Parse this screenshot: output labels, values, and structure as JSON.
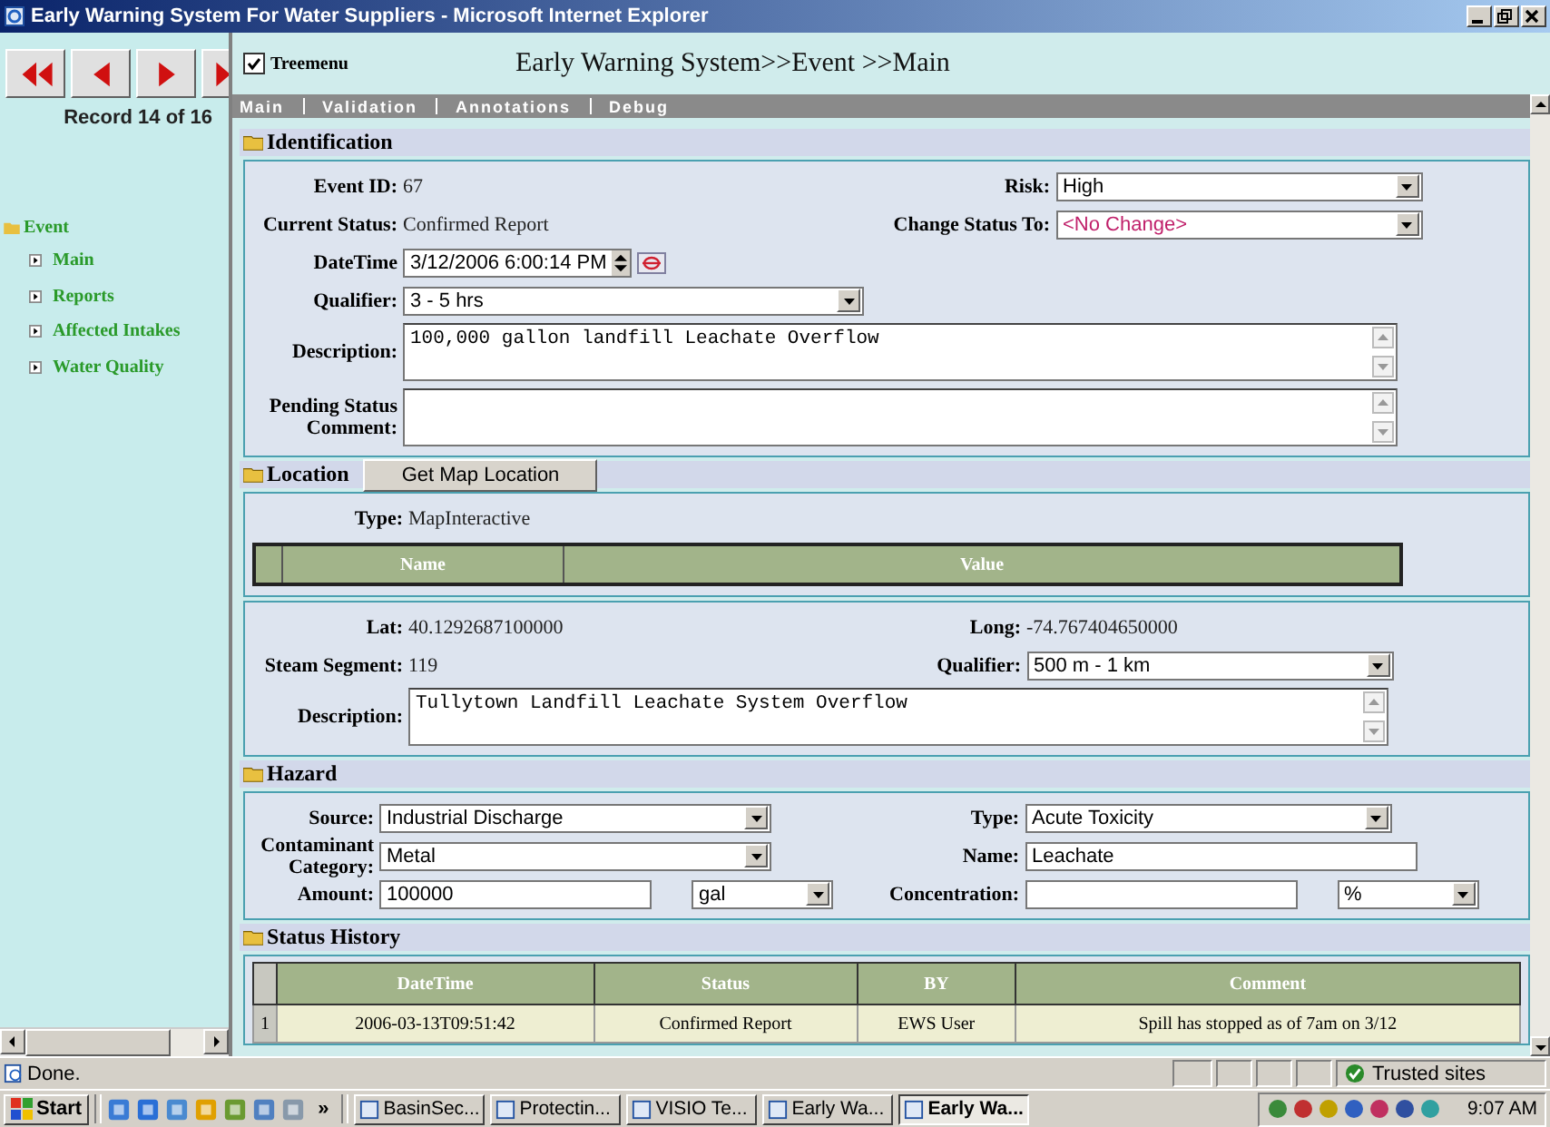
{
  "window": {
    "title": "Early Warning System For Water Suppliers - Microsoft Internet Explorer"
  },
  "nav": {
    "buttons": [
      {
        "kind": "first"
      },
      {
        "kind": "prev"
      },
      {
        "kind": "next"
      },
      {
        "kind": "last"
      }
    ],
    "record": "Record 14 of 16"
  },
  "tree": {
    "label": "Event",
    "children": [
      {
        "label": "Main"
      },
      {
        "label": "Reports"
      },
      {
        "label": "Affected Intakes"
      },
      {
        "label": "Water Quality"
      }
    ]
  },
  "header": {
    "treemenu": {
      "label": "Treemenu",
      "checked": true
    },
    "title": "Early Warning System>>Event >>Main"
  },
  "menu": [
    "Main",
    "Validation",
    "Annotations",
    "Debug"
  ],
  "identification": {
    "title": "Identification",
    "rows": [
      {
        "cells": [
          {
            "label": "Event ID:",
            "kind": "text",
            "value": "67"
          },
          {
            "label": "Risk:",
            "kind": "select",
            "value": "High"
          }
        ]
      },
      {
        "cells": [
          {
            "label": "Current Status:",
            "kind": "text",
            "value": "Confirmed Report"
          },
          {
            "label": "Change Status To:",
            "kind": "select",
            "value": "<No Change>",
            "highlight": true
          }
        ]
      },
      {
        "cells": [
          {
            "label": "DateTime",
            "kind": "datetime",
            "value": "3/12/2006 6:00:14 PM"
          }
        ]
      },
      {
        "cells": [
          {
            "label": "Qualifier:",
            "kind": "select",
            "value": "3 - 5 hrs"
          }
        ]
      },
      {
        "cells": [
          {
            "label": "Description:",
            "kind": "textarea",
            "value": "100,000 gallon landfill Leachate Overflow"
          }
        ]
      },
      {
        "cells": [
          {
            "label": "Pending Status Comment:",
            "kind": "textarea"
          }
        ]
      }
    ]
  },
  "location": {
    "title": "Location",
    "button": "Get Map Location",
    "type": {
      "label": "Type:",
      "value": "MapInteractive"
    },
    "grid_columns": [
      "Name",
      "Value"
    ],
    "rows": [
      {
        "cells": [
          {
            "label": "Lat:",
            "kind": "text",
            "value": "40.1292687100000"
          },
          {
            "label": "Long:",
            "kind": "text",
            "value": "-74.767404650000"
          }
        ]
      },
      {
        "cells": [
          {
            "label": "Steam Segment:",
            "kind": "text",
            "value": "119"
          },
          {
            "label": "Qualifier:",
            "kind": "select",
            "value": "500 m - 1 km"
          }
        ]
      },
      {
        "cells": [
          {
            "label": "Description:",
            "kind": "textarea",
            "value": "Tullytown Landfill Leachate System Overflow"
          }
        ]
      }
    ]
  },
  "hazard": {
    "title": "Hazard",
    "rows": [
      {
        "cells": [
          {
            "label": "Source:",
            "kind": "select",
            "value": "Industrial Discharge"
          },
          {
            "label": "Type:",
            "kind": "select",
            "value": "Acute Toxicity"
          }
        ]
      },
      {
        "cells": [
          {
            "label": "Contaminant Category:",
            "kind": "select",
            "value": "Metal"
          },
          {
            "label": "Name:",
            "kind": "input",
            "value": "Leachate"
          }
        ]
      },
      {
        "cells": [
          {
            "label": "Amount:",
            "kind": "amount",
            "value": "100000",
            "unit": "gal"
          },
          {
            "label": "Concentration:",
            "kind": "amount",
            "unit": "%"
          }
        ]
      }
    ]
  },
  "status_history": {
    "title": "Status History",
    "columns": [
      "DateTime",
      "Status",
      "BY",
      "Comment"
    ],
    "rows": [
      {
        "number": "1",
        "cells": [
          "2006-03-13T09:51:42",
          "Confirmed Report",
          "EWS User",
          "Spill has stopped as of 7am on 3/12"
        ]
      }
    ]
  },
  "status_bar": {
    "text": "Done.",
    "zone": "Trusted sites"
  },
  "taskbar": {
    "start": "Start",
    "more": "»",
    "tasks": [
      {
        "label": "BasinSec...",
        "selected": false
      },
      {
        "label": "Protectin...",
        "selected": false
      },
      {
        "label": "VISIO Te...",
        "selected": false
      },
      {
        "label": "Early Wa...",
        "selected": false
      },
      {
        "label": "Early Wa...",
        "selected": true
      }
    ],
    "time": "9:07 AM"
  }
}
